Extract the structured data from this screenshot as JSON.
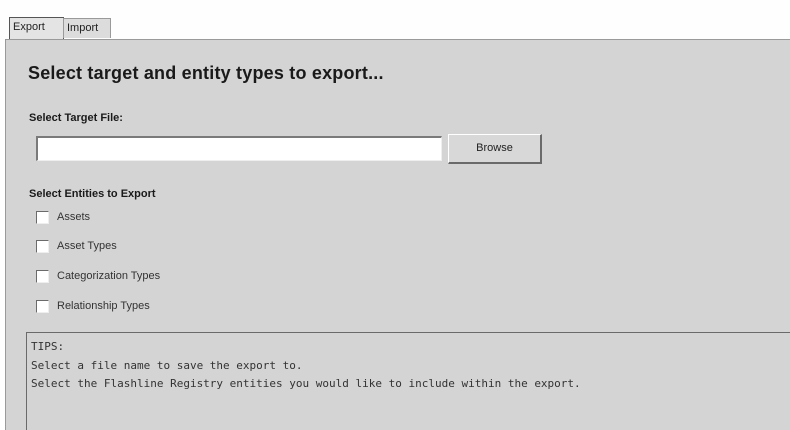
{
  "tabs": [
    {
      "label": "Export",
      "active": true
    },
    {
      "label": "Import",
      "active": false
    }
  ],
  "export": {
    "heading": "Select target and entity types to export...",
    "target_label": "Select Target File:",
    "target_value": "",
    "browse_label": "Browse",
    "entities_label": "Select Entities to Export",
    "entities": [
      {
        "label": "Assets",
        "checked": false
      },
      {
        "label": "Asset Types",
        "checked": false
      },
      {
        "label": "Categorization Types",
        "checked": false
      },
      {
        "label": "Relationship Types",
        "checked": false
      }
    ],
    "tips": {
      "title": "TIPS:",
      "lines": [
        "Select a file name to save the export to.",
        "Select the Flashline Registry entities you would like to include within the export."
      ]
    }
  },
  "colors": {
    "panel_background": "#d4d4d4",
    "input_background": "#ffffff"
  }
}
